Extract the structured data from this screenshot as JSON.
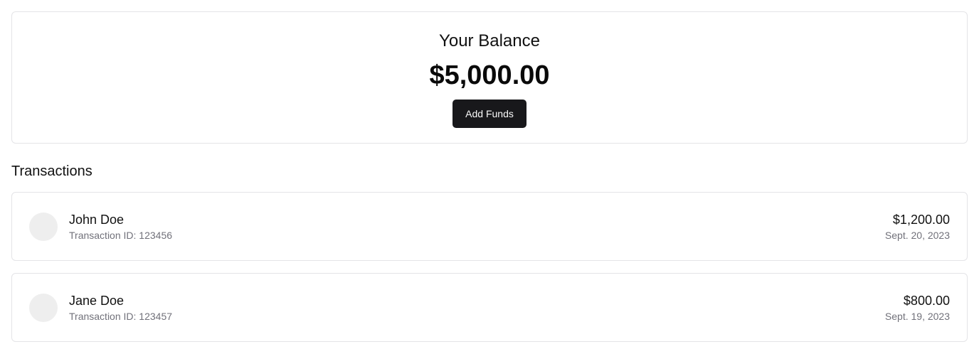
{
  "balance": {
    "title": "Your Balance",
    "amount": "$5,000.00",
    "add_funds_label": "Add Funds"
  },
  "transactions": {
    "section_title": "Transactions",
    "items": [
      {
        "name": "John Doe",
        "transaction_id": "Transaction ID: 123456",
        "amount": "$1,200.00",
        "date": "Sept. 20, 2023"
      },
      {
        "name": "Jane Doe",
        "transaction_id": "Transaction ID: 123457",
        "amount": "$800.00",
        "date": "Sept. 19, 2023"
      }
    ]
  },
  "colors": {
    "button_bg": "#18181b",
    "card_border": "#e4e4e7",
    "muted_text": "#71717a",
    "avatar_bg": "#eeeeee"
  }
}
